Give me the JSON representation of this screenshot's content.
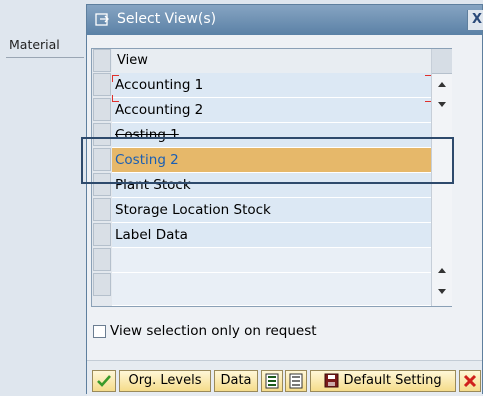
{
  "background": {
    "field_label": "Material"
  },
  "dialog": {
    "title": "Select View(s)",
    "close_label": "X",
    "table": {
      "column_header": "View",
      "rows": [
        {
          "label": "Accounting 1"
        },
        {
          "label": "Accounting 2"
        },
        {
          "label": "Costing 1"
        },
        {
          "label": "Costing 2",
          "selected": true
        },
        {
          "label": "Plant Stock"
        },
        {
          "label": "Storage Location Stock"
        },
        {
          "label": "Label Data"
        }
      ]
    },
    "checkbox_label": "View selection only on request",
    "buttons": {
      "org_levels": "Org. Levels",
      "data": "Data",
      "default_setting": "Default Setting"
    }
  },
  "colors": {
    "selected_row": "#e6b86a",
    "selected_text": "#1a5fb4",
    "title_bar": "#6b8db2",
    "highlight_border": "#2e4a6c",
    "confirm_icon": "#3a9a2a",
    "cancel_icon": "#d0201c"
  }
}
